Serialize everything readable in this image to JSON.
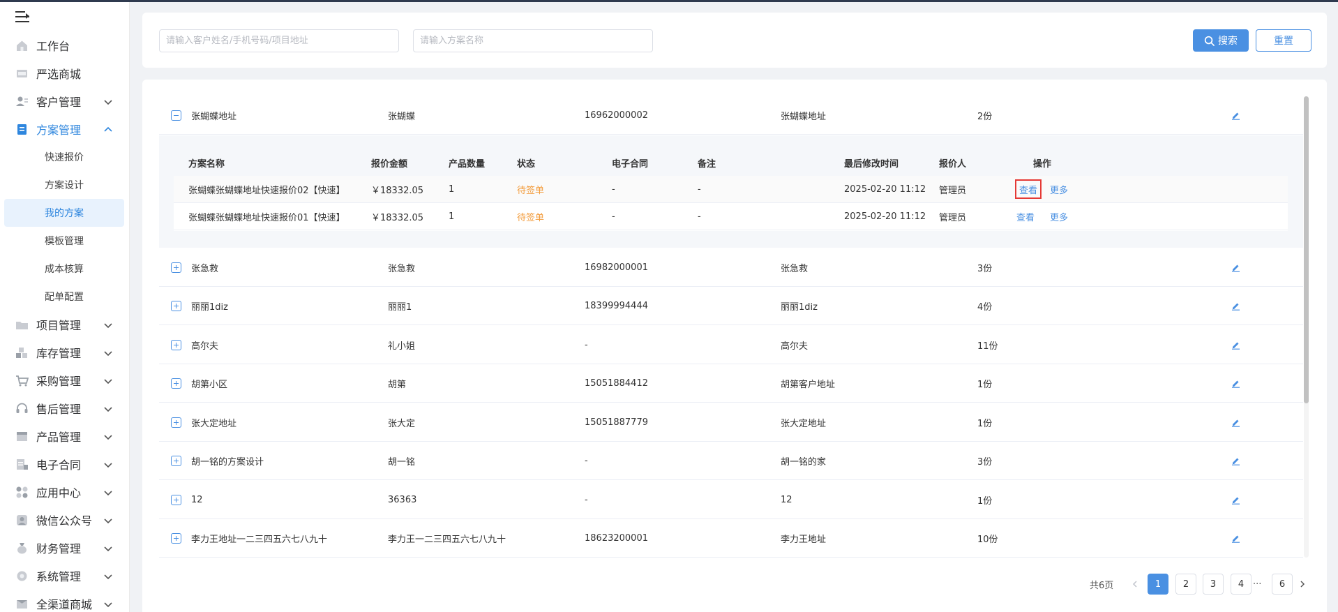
{
  "sidebar": {
    "items": [
      {
        "label": "工作台",
        "icon": "home-icon",
        "chevron": ""
      },
      {
        "label": "严选商城",
        "icon": "shop-icon",
        "chevron": ""
      },
      {
        "label": "客户管理",
        "icon": "customer-icon",
        "chevron": "down"
      },
      {
        "label": "方案管理",
        "icon": "plan-icon",
        "chevron": "up",
        "open": true
      },
      {
        "label": "项目管理",
        "icon": "project-icon",
        "chevron": "down"
      },
      {
        "label": "库存管理",
        "icon": "inventory-icon",
        "chevron": "down"
      },
      {
        "label": "采购管理",
        "icon": "cart-icon",
        "chevron": "down"
      },
      {
        "label": "售后管理",
        "icon": "headset-icon",
        "chevron": "down"
      },
      {
        "label": "产品管理",
        "icon": "product-icon",
        "chevron": "down"
      },
      {
        "label": "电子合同",
        "icon": "contract-icon",
        "chevron": "down"
      },
      {
        "label": "应用中心",
        "icon": "apps-icon",
        "chevron": "down"
      },
      {
        "label": "微信公众号",
        "icon": "wechat-icon",
        "chevron": "down"
      },
      {
        "label": "财务管理",
        "icon": "finance-icon",
        "chevron": "down"
      },
      {
        "label": "系统管理",
        "icon": "system-icon",
        "chevron": "down"
      },
      {
        "label": "全渠道商城",
        "icon": "mall-icon",
        "chevron": "down"
      }
    ],
    "submenu": [
      "快速报价",
      "方案设计",
      "我的方案",
      "模板管理",
      "成本核算",
      "配单配置"
    ],
    "active_sub": "我的方案"
  },
  "search": {
    "customer_placeholder": "请输入客户姓名/手机号码/项目地址",
    "plan_placeholder": "请输入方案名称",
    "search_label": "搜索",
    "reset_label": "重置"
  },
  "rows": [
    {
      "name": "张蝴蝶地址",
      "customer": "张蝴蝶",
      "phone": "16962000002",
      "address": "张蝴蝶地址",
      "count": "2份",
      "expanded": true
    },
    {
      "name": "张急救",
      "customer": "张急救",
      "phone": "16982000001",
      "address": "张急救",
      "count": "3份"
    },
    {
      "name": "丽丽1diz",
      "customer": "丽丽1",
      "phone": "18399994444",
      "address": "丽丽1diz",
      "count": "4份"
    },
    {
      "name": "高尔夫",
      "customer": "礼小姐",
      "phone": "-",
      "address": "高尔夫",
      "count": "11份"
    },
    {
      "name": "胡第小区",
      "customer": "胡第",
      "phone": "15051884412",
      "address": "胡第客户地址",
      "count": "1份"
    },
    {
      "name": "张大定地址",
      "customer": "张大定",
      "phone": "15051887779",
      "address": "张大定地址",
      "count": "1份"
    },
    {
      "name": "胡一铭的方案设计",
      "customer": "胡一铭",
      "phone": "-",
      "address": "胡一铭的家",
      "count": "3份"
    },
    {
      "name": "12",
      "customer": "36363",
      "phone": "-",
      "address": "12",
      "count": "1份"
    },
    {
      "name": "李力王地址一二三四五六七八九十",
      "customer": "李力王一二三四五六七八九十",
      "phone": "18623200001",
      "address": "李力王地址",
      "count": "10份"
    }
  ],
  "inner_table": {
    "headers": {
      "name": "方案名称",
      "amount": "报价金额",
      "qty": "产品数量",
      "status": "状态",
      "contract": "电子合同",
      "remark": "备注",
      "time": "最后修改时间",
      "quoter": "报价人",
      "ops": "操作"
    },
    "rows": [
      {
        "name": "张蝴蝶张蝴蝶地址快速报价02【快速】",
        "amount": "￥18332.05",
        "qty": "1",
        "status": "待签单",
        "contract": "-",
        "remark": "-",
        "time": "2025-02-20 11:12",
        "quoter": "管理员",
        "view": "查看",
        "more": "更多"
      },
      {
        "name": "张蝴蝶张蝴蝶地址快速报价01【快速】",
        "amount": "￥18332.05",
        "qty": "1",
        "status": "待签单",
        "contract": "-",
        "remark": "-",
        "time": "2025-02-20 11:12",
        "quoter": "管理员",
        "view": "查看",
        "more": "更多"
      }
    ]
  },
  "pagination": {
    "total": "共6页",
    "pages": [
      "1",
      "2",
      "3",
      "4",
      "6"
    ],
    "ellipsis": "···",
    "current": "1"
  },
  "colors": {
    "primary": "#4a90e2",
    "status_pending": "#f39c3c",
    "highlight_box": "#e53935"
  }
}
